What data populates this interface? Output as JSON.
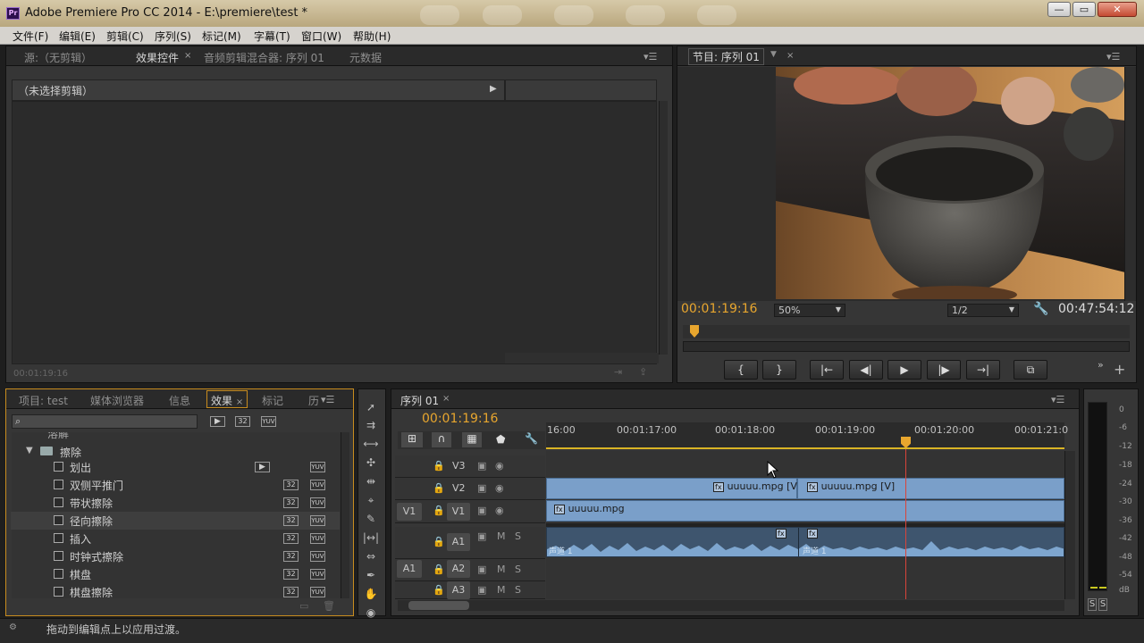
{
  "window": {
    "title": "Adobe Premiere Pro CC 2014 - E:\\premiere\\test *",
    "app_icon": "Pr",
    "min": "—",
    "max": "▭",
    "close": "✕"
  },
  "menu": [
    "文件(F)",
    "编辑(E)",
    "剪辑(C)",
    "序列(S)",
    "标记(M)",
    "字幕(T)",
    "窗口(W)",
    "帮助(H)"
  ],
  "source_panel": {
    "tabs": [
      "源:（无剪辑）",
      "效果控件",
      "音频剪辑混合器: 序列 01",
      "元数据"
    ],
    "no_clip": "（未选择剪辑）",
    "timecode": "00:01:19:16"
  },
  "program_panel": {
    "tab": "节目: 序列 01",
    "timecode": "00:01:19:16",
    "zoom": "50%",
    "resolution": "1/2",
    "duration": "00:47:54:12",
    "controls": [
      "{",
      "}",
      "|←",
      "◀|",
      "▶",
      "|▶",
      "→|",
      "⧉"
    ]
  },
  "project_panel": {
    "tabs": [
      "项目: test",
      "媒体浏览器",
      "信息",
      "效果",
      "标记",
      "历"
    ],
    "search_placeholder": "",
    "folder_partial": "溶解",
    "folder": "擦除",
    "items": [
      {
        "label": "划出",
        "b32": false
      },
      {
        "label": "双侧平推门",
        "b32": true
      },
      {
        "label": "带状擦除",
        "b32": true
      },
      {
        "label": "径向擦除",
        "b32": true
      },
      {
        "label": "插入",
        "b32": true
      },
      {
        "label": "时钟式擦除",
        "b32": true
      },
      {
        "label": "棋盘",
        "b32": true
      },
      {
        "label": "棋盘擦除",
        "b32": true
      }
    ],
    "badge_32": "32",
    "badge_yuv": "YUV"
  },
  "timeline": {
    "tab": "序列 01",
    "timecode": "00:01:19:16",
    "ruler": [
      "16:00",
      "00:01:17:00",
      "00:01:18:00",
      "00:01:19:00",
      "00:01:20:00",
      "00:01:21:0"
    ],
    "tracks": {
      "video": [
        "V3",
        "V2",
        "V1"
      ],
      "audio": [
        "A1",
        "A2",
        "A3"
      ],
      "src_v": "V1",
      "src_a": "A1"
    },
    "clips": {
      "v2a": "uuuuu.mpg [V]",
      "v2b": "uuuuu.mpg [V]",
      "v1": "uuuuu.mpg",
      "a1a": "声道 1",
      "a1b": "声道 1"
    },
    "fx": "fx",
    "m": "M",
    "s": "S"
  },
  "meter": {
    "labels": [
      "0",
      "-6",
      "-12",
      "-18",
      "-24",
      "-30",
      "-36",
      "-42",
      "-48",
      "-54",
      "dB"
    ],
    "s1": "S",
    "s2": "S"
  },
  "status": "拖动到编辑点上以应用过渡。",
  "colors": {
    "accent": "#e8a62e",
    "clip": "#7a9fc9",
    "playhead": "#d9443a"
  }
}
